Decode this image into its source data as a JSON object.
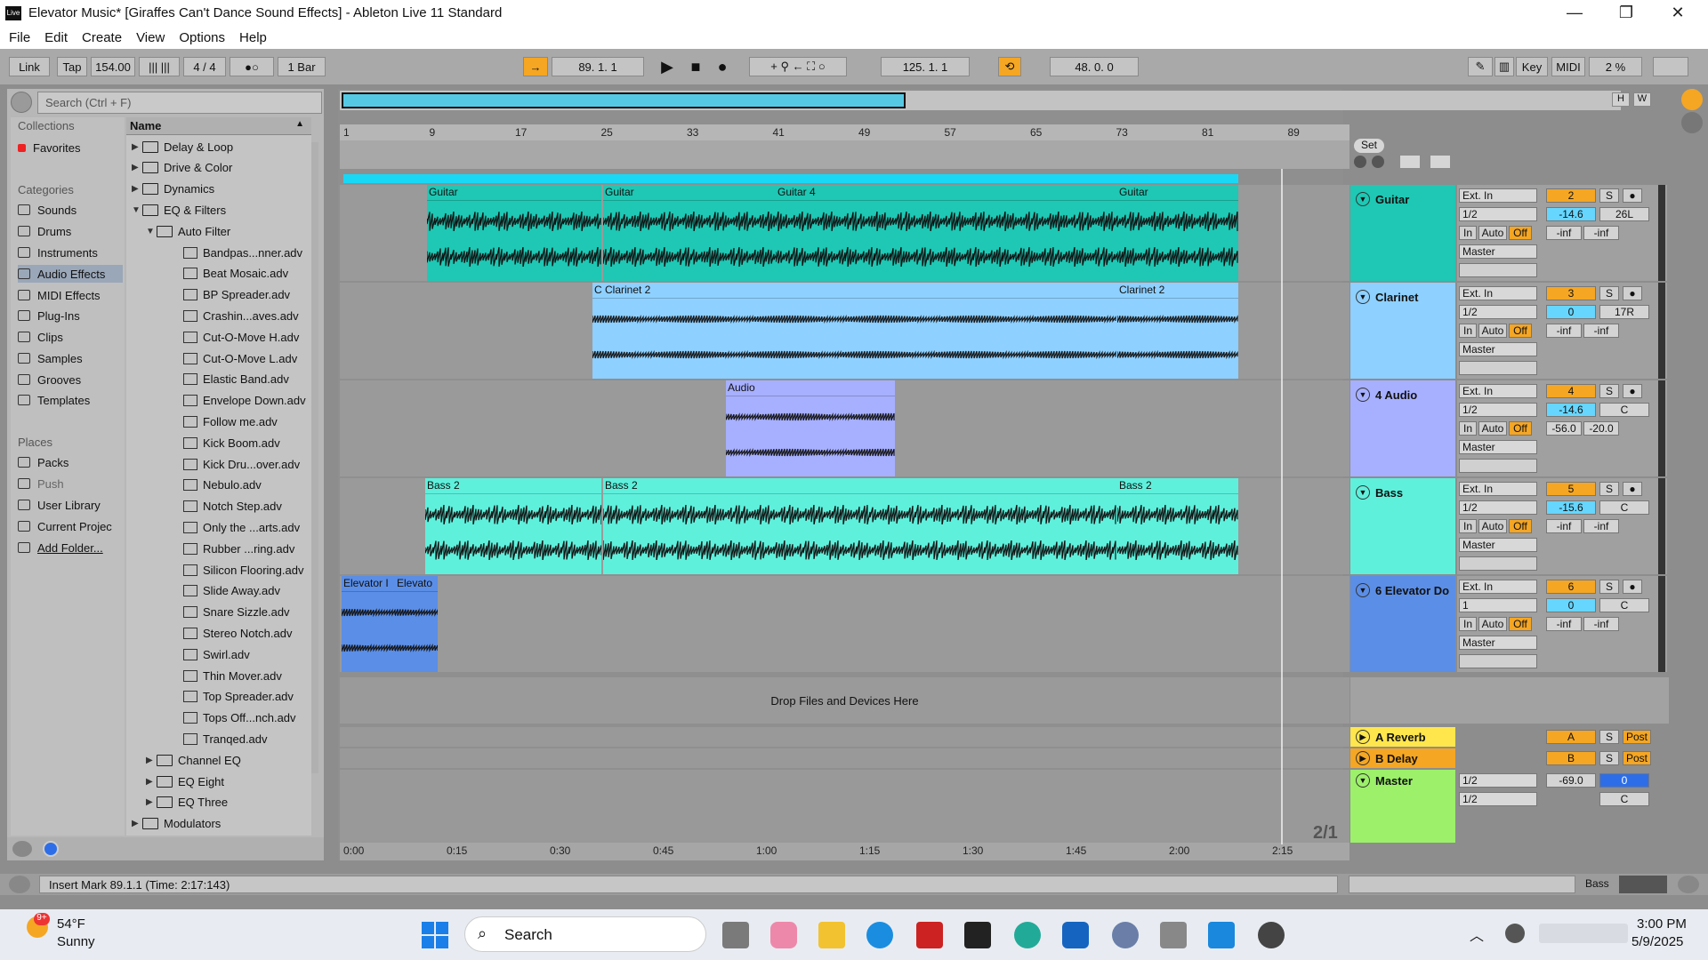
{
  "window": {
    "title": "Elevator Music* [Giraffes Can't Dance Sound Effects] - Ableton Live 11 Standard",
    "logo": "Live",
    "minimize": "—",
    "maximize": "❐",
    "close": "✕"
  },
  "menu": [
    "File",
    "Edit",
    "Create",
    "View",
    "Options",
    "Help"
  ],
  "control_bar": {
    "link": "Link",
    "tap": "Tap",
    "tempo": "154.00",
    "sig": "4 / 4",
    "metro": "●○",
    "quantize": "1 Bar",
    "position": "89.  1.  1",
    "loop_start": "125.  1.  1",
    "loop_length": "48.  0.  0",
    "key": "Key",
    "midi": "MIDI",
    "cpu": "2 %"
  },
  "browser": {
    "search_placeholder": "Search (Ctrl + F)",
    "collections_header": "Collections",
    "favorites": "Favorites",
    "categories_header": "Categories",
    "categories": [
      "Sounds",
      "Drums",
      "Instruments",
      "Audio Effects",
      "MIDI Effects",
      "Plug-Ins",
      "Clips",
      "Samples",
      "Grooves",
      "Templates"
    ],
    "selected_category": "Audio Effects",
    "places_header": "Places",
    "places": [
      "Packs",
      "Push",
      "User Library",
      "Current Projec",
      "Add Folder..."
    ],
    "name_header": "Name",
    "files": [
      {
        "label": "Delay & Loop",
        "type": "folder",
        "indent": 0,
        "tri": "▶"
      },
      {
        "label": "Drive & Color",
        "type": "folder",
        "indent": 0,
        "tri": "▶"
      },
      {
        "label": "Dynamics",
        "type": "folder",
        "indent": 0,
        "tri": "▶"
      },
      {
        "label": "EQ & Filters",
        "type": "folder",
        "indent": 0,
        "tri": "▼"
      },
      {
        "label": "Auto Filter",
        "type": "folder",
        "indent": 1,
        "tri": "▼"
      },
      {
        "label": "Bandpas...nner.adv",
        "type": "file",
        "indent": 2,
        "tri": ""
      },
      {
        "label": "Beat Mosaic.adv",
        "type": "file",
        "indent": 2,
        "tri": ""
      },
      {
        "label": "BP Spreader.adv",
        "type": "file",
        "indent": 2,
        "tri": ""
      },
      {
        "label": "Crashin...aves.adv",
        "type": "file",
        "indent": 2,
        "tri": ""
      },
      {
        "label": "Cut-O-Move H.adv",
        "type": "file",
        "indent": 2,
        "tri": ""
      },
      {
        "label": "Cut-O-Move L.adv",
        "type": "file",
        "indent": 2,
        "tri": ""
      },
      {
        "label": "Elastic Band.adv",
        "type": "file",
        "indent": 2,
        "tri": ""
      },
      {
        "label": "Envelope Down.adv",
        "type": "file",
        "indent": 2,
        "tri": ""
      },
      {
        "label": "Follow me.adv",
        "type": "file",
        "indent": 2,
        "tri": ""
      },
      {
        "label": "Kick Boom.adv",
        "type": "file",
        "indent": 2,
        "tri": ""
      },
      {
        "label": "Kick Dru...over.adv",
        "type": "file",
        "indent": 2,
        "tri": ""
      },
      {
        "label": "Nebulo.adv",
        "type": "file",
        "indent": 2,
        "tri": ""
      },
      {
        "label": "Notch Step.adv",
        "type": "file",
        "indent": 2,
        "tri": ""
      },
      {
        "label": "Only the ...arts.adv",
        "type": "file",
        "indent": 2,
        "tri": ""
      },
      {
        "label": "Rubber ...ring.adv",
        "type": "file",
        "indent": 2,
        "tri": ""
      },
      {
        "label": "Silicon Flooring.adv",
        "type": "file",
        "indent": 2,
        "tri": ""
      },
      {
        "label": "Slide Away.adv",
        "type": "file",
        "indent": 2,
        "tri": ""
      },
      {
        "label": "Snare Sizzle.adv",
        "type": "file",
        "indent": 2,
        "tri": ""
      },
      {
        "label": "Stereo Notch.adv",
        "type": "file",
        "indent": 2,
        "tri": ""
      },
      {
        "label": "Swirl.adv",
        "type": "file",
        "indent": 2,
        "tri": ""
      },
      {
        "label": "Thin Mover.adv",
        "type": "file",
        "indent": 2,
        "tri": ""
      },
      {
        "label": "Top Spreader.adv",
        "type": "file",
        "indent": 2,
        "tri": ""
      },
      {
        "label": "Tops Off...nch.adv",
        "type": "file",
        "indent": 2,
        "tri": ""
      },
      {
        "label": "Tranqed.adv",
        "type": "file",
        "indent": 2,
        "tri": ""
      },
      {
        "label": "Channel EQ",
        "type": "folder",
        "indent": 1,
        "tri": "▶"
      },
      {
        "label": "EQ Eight",
        "type": "folder",
        "indent": 1,
        "tri": "▶"
      },
      {
        "label": "EQ Three",
        "type": "folder",
        "indent": 1,
        "tri": "▶"
      },
      {
        "label": "Modulators",
        "type": "folder",
        "indent": 0,
        "tri": "▶"
      }
    ]
  },
  "ruler": [
    "1",
    "9",
    "17",
    "25",
    "33",
    "41",
    "49",
    "57",
    "65",
    "73",
    "81",
    "89"
  ],
  "set_label": "Set",
  "timeline": [
    "0:00",
    "0:15",
    "0:30",
    "0:45",
    "1:00",
    "1:15",
    "1:30",
    "1:45",
    "2:00",
    "2:15"
  ],
  "tracks": [
    {
      "name": "Guitar",
      "color": "#1ec8b4",
      "num": "2",
      "vol": "-14.6",
      "pan": "26L",
      "inp": "Ext. In",
      "ch": "1/2",
      "out": "Master",
      "s1": "-inf",
      "s2": "-inf",
      "clips": [
        {
          "name": "Guitar"
        },
        {
          "name": "Guitar"
        },
        {
          "name": "Guitar 4"
        },
        {
          "name": "Guitar"
        }
      ]
    },
    {
      "name": "Clarinet",
      "color": "#8ed0ff",
      "num": "3",
      "vol": "0",
      "pan": "17R",
      "inp": "Ext. In",
      "ch": "1/2",
      "out": "Master",
      "s1": "-inf",
      "s2": "-inf",
      "clips": [
        {
          "name": "C"
        },
        {
          "name": "Clarinet 2"
        },
        {
          "name": "Clarinet 2"
        }
      ]
    },
    {
      "name": "4 Audio",
      "color": "#a7b0ff",
      "num": "4",
      "vol": "-14.6",
      "pan": "C",
      "inp": "Ext. In",
      "ch": "1/2",
      "out": "Master",
      "s1": "-56.0",
      "s2": "-20.0",
      "clips": [
        {
          "name": "Audio"
        }
      ]
    },
    {
      "name": "Bass",
      "color": "#5ff0dc",
      "num": "5",
      "vol": "-15.6",
      "pan": "C",
      "inp": "Ext. In",
      "ch": "1/2",
      "out": "Master",
      "s1": "-inf",
      "s2": "-inf",
      "clips": [
        {
          "name": "Bass 2"
        },
        {
          "name": "Bass 2"
        },
        {
          "name": "Bass 2"
        }
      ]
    },
    {
      "name": "6 Elevator Do",
      "color": "#5b8ee6",
      "num": "6",
      "vol": "0",
      "pan": "C",
      "inp": "Ext. In",
      "ch": "1",
      "out": "Master",
      "s1": "-inf",
      "s2": "-inf",
      "clips": [
        {
          "name": "Elevator I"
        },
        {
          "name": "Elevato"
        }
      ]
    }
  ],
  "returns": [
    {
      "name": "A Reverb",
      "letter": "A",
      "color": "#ffe64d"
    },
    {
      "name": "B Delay",
      "letter": "B",
      "color": "#f5a623"
    }
  ],
  "master": {
    "name": "Master",
    "color": "#9cf06a",
    "vol": "-69.0",
    "out": "1/2",
    "cue": "1/2",
    "pan": "C",
    "val": "0"
  },
  "mixer_labels": {
    "in": "In",
    "auto": "Auto",
    "off": "Off",
    "s": "S",
    "post": "Post"
  },
  "drop_text": "Drop Files and Devices Here",
  "page_indicator": "2/1",
  "status": "Insert Mark 89.1.1 (Time: 2:17:143)",
  "status_right": "Bass",
  "taskbar": {
    "weather_temp": "54°F",
    "weather_text": "Sunny",
    "weather_badge": "9+",
    "search": "Search",
    "time": "3:00 PM",
    "date": "5/9/2025"
  }
}
